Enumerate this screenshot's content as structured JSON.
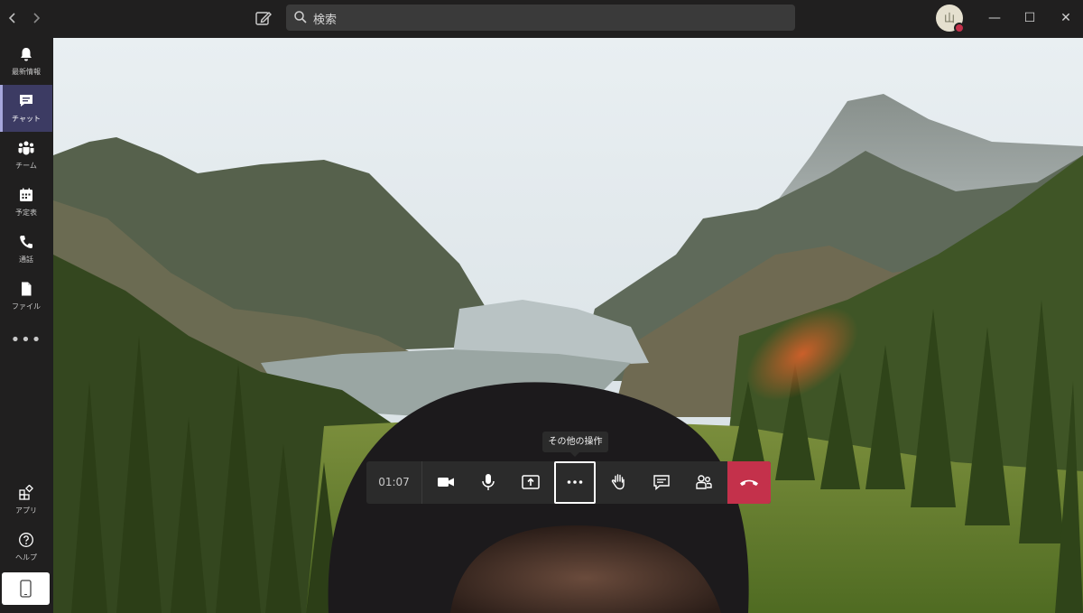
{
  "titlebar": {
    "back_icon": "chevron-left",
    "forward_icon": "chevron-right",
    "compose_icon": "compose",
    "search_placeholder": "検索",
    "avatar_initial": "山",
    "presence_color": "#c4314b",
    "minimize": "—",
    "maximize": "☐",
    "close": "✕"
  },
  "rail": {
    "items": [
      {
        "label": "最新情報",
        "icon": "bell",
        "active": false
      },
      {
        "label": "チャット",
        "icon": "chat",
        "active": true
      },
      {
        "label": "チーム",
        "icon": "teams",
        "active": false
      },
      {
        "label": "予定表",
        "icon": "calendar",
        "active": false
      },
      {
        "label": "通話",
        "icon": "phone",
        "active": false
      },
      {
        "label": "ファイル",
        "icon": "file",
        "active": false
      }
    ],
    "more": "•••",
    "bottom": [
      {
        "label": "アプリ",
        "icon": "apps"
      },
      {
        "label": "ヘルプ",
        "icon": "help"
      }
    ],
    "device_icon": "mobile"
  },
  "call": {
    "timer": "01:07",
    "tooltip": "その他の操作",
    "buttons": [
      "camera",
      "microphone",
      "share-screen",
      "more-actions",
      "raise-hand",
      "chat",
      "participants",
      "hang-up"
    ],
    "hangup_color": "#c4314b",
    "accent": "#3c3b63"
  }
}
